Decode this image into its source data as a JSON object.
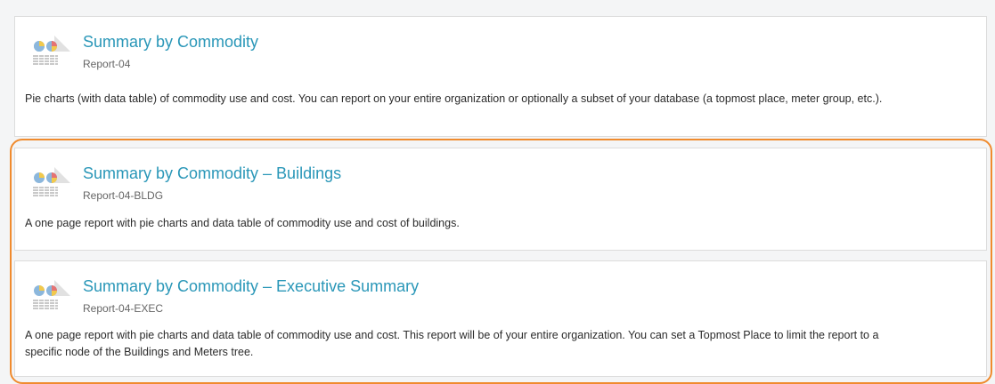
{
  "reports": [
    {
      "title": "Summary by Commodity",
      "code": "Report-04",
      "description": "Pie charts (with data table) of commodity use and cost. You can report on your entire organization or optionally a subset of your database (a topmost place, meter group, etc.).",
      "icon": "report-pie-table-icon"
    },
    {
      "title": "Summary by Commodity – Buildings",
      "code": "Report-04-BLDG",
      "description": "A one page report with pie charts and data table of commodity use and cost of buildings.",
      "icon": "report-pie-table-icon"
    },
    {
      "title": "Summary by Commodity – Executive Summary",
      "code": "Report-04-EXEC",
      "description": "A one page report with pie charts and data table of commodity use and cost. This report will be of your entire organization. You can set a Topmost Place to limit the report to a specific node of the Buildings and Meters tree.",
      "icon": "report-pie-table-icon"
    }
  ],
  "colors": {
    "title": "#2a97b8",
    "highlight": "#f08b2e",
    "border": "#dcdcdc"
  }
}
